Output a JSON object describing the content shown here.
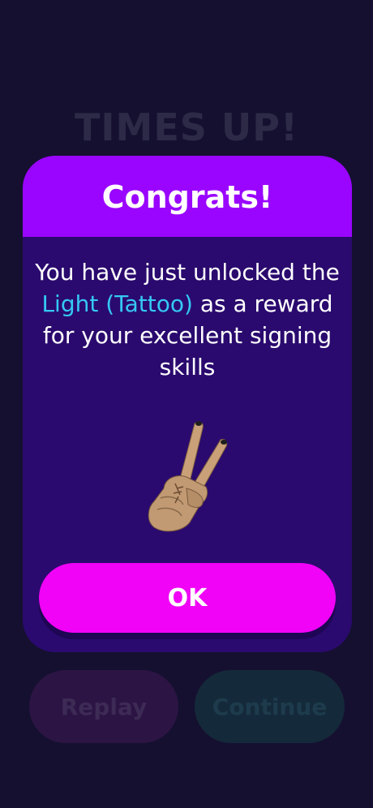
{
  "background": {
    "title": "TIMES UP!",
    "replay_label": "Replay",
    "continue_label": "Continue"
  },
  "modal": {
    "title": "Congrats!",
    "message_before": "You have just unlocked the ",
    "reward_name": "Light (Tattoo)",
    "message_after": " as a reward for your excellent signing skills",
    "reward_icon": "peace-sign-hand-icon",
    "ok_label": "OK"
  },
  "colors": {
    "background": "#151030",
    "modal_header": "#9a05ff",
    "modal_body": "#2a0a6e",
    "ok_button": "#f003f6",
    "reward_text": "#35c8f4"
  }
}
